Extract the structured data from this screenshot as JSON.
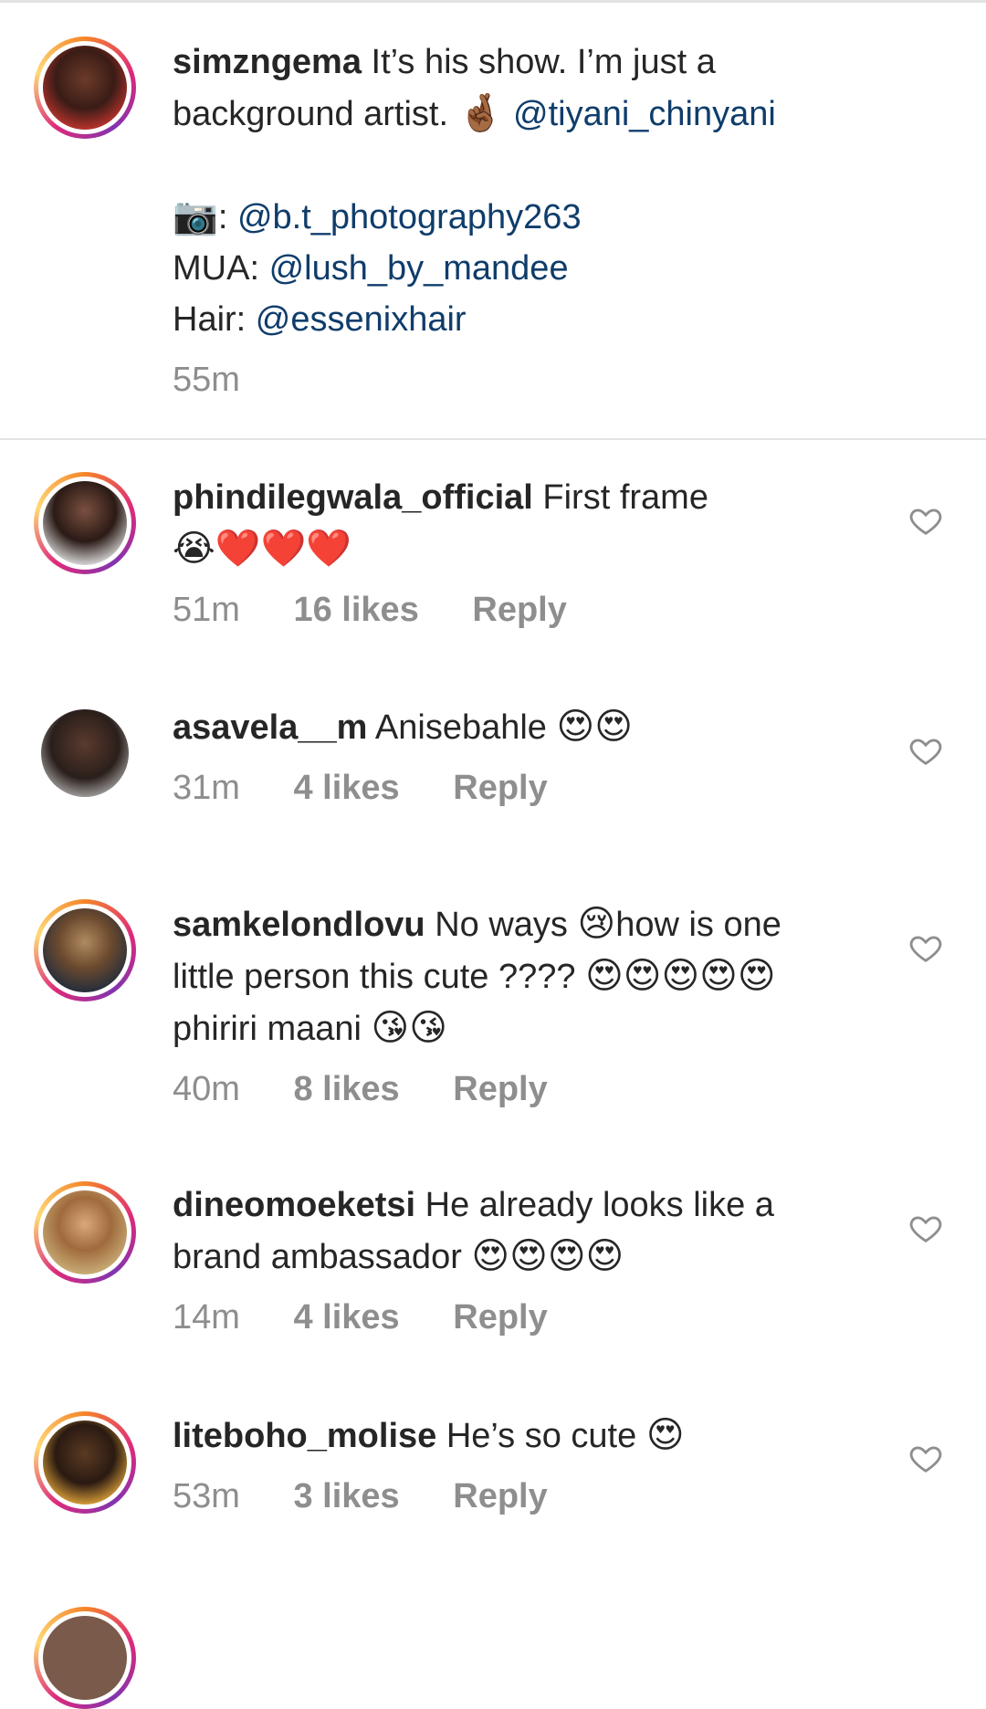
{
  "caption": {
    "username": "simzngema",
    "line1_text": "It’s his show. I’m just a",
    "line2_text": "background artist.",
    "line2_emoji": "🤞🏾",
    "mention1": "@tiyani_chinyani",
    "camera_emoji": "📷",
    "camera_sep": ":",
    "mention_photo": "@b.t_photography263",
    "mua_label": "MUA:",
    "mention_mua": "@lush_by_mandee",
    "hair_label": "Hair:",
    "mention_hair": "@essenixhair",
    "time": "55m"
  },
  "comments": [
    {
      "username": "phindilegwala_official",
      "text": "First frame",
      "emoji_line": "😭❤️❤️❤️",
      "time": "51m",
      "likes": "16 likes",
      "reply": "Reply"
    },
    {
      "username": "asavela__m",
      "text": "Anisebahle",
      "emoji": "😍😍",
      "time": "31m",
      "likes": "4 likes",
      "reply": "Reply"
    },
    {
      "username": "samkelondlovu",
      "text_a": "No ways",
      "emoji_a": "😢",
      "text_b": "how is one",
      "line2": "little person this cute ????",
      "emoji_b": "😍😍😍😍😍",
      "line3": "phiriri maani",
      "emoji_c": "😘😘",
      "time": "40m",
      "likes": "8 likes",
      "reply": "Reply"
    },
    {
      "username": "dineomoeketsi",
      "text": "He already looks like a",
      "line2": "brand ambassador",
      "emoji": "😍😍😍😍",
      "time": "14m",
      "likes": "4 likes",
      "reply": "Reply"
    },
    {
      "username": "liteboho_molise",
      "text": "He’s so cute",
      "emoji": "😍",
      "time": "53m",
      "likes": "3 likes",
      "reply": "Reply"
    }
  ],
  "colors": {
    "mention": "#0f3d6b",
    "meta": "#8e8e8e",
    "divider": "#e3e3e3"
  }
}
